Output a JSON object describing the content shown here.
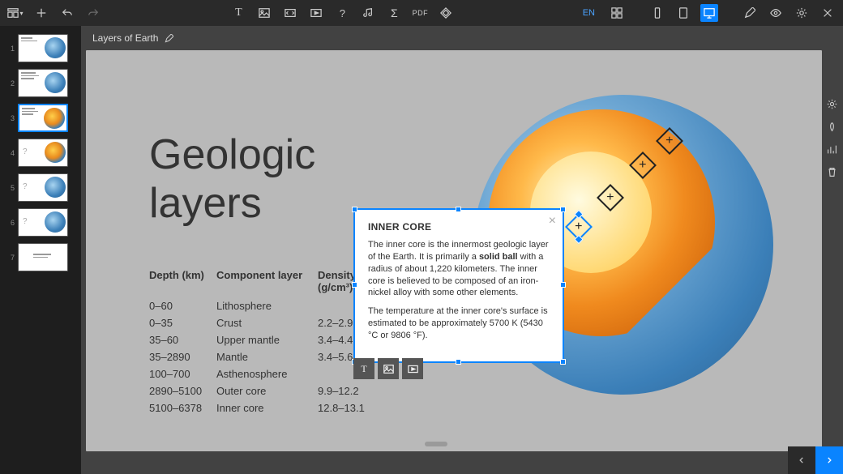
{
  "doc_title": "Layers of Earth",
  "lang": "EN",
  "pdf_label": "PDF",
  "slide_title_1": "Geologic",
  "slide_title_2": "layers",
  "table": {
    "head": {
      "depth": "Depth (km)",
      "layer": "Component layer",
      "density": "Density (g/cm³)"
    },
    "rows": [
      {
        "depth": "0–60",
        "layer": "Lithosphere",
        "density": ""
      },
      {
        "depth": "0–35",
        "layer": "Crust",
        "density": "2.2–2.9"
      },
      {
        "depth": "35–60",
        "layer": "Upper mantle",
        "density": "3.4–4.4"
      },
      {
        "depth": "35–2890",
        "layer": "Mantle",
        "density": "3.4–5.6"
      },
      {
        "depth": "100–700",
        "layer": "Asthenosphere",
        "density": ""
      },
      {
        "depth": "2890–5100",
        "layer": "Outer core",
        "density": "9.9–12.2"
      },
      {
        "depth": "5100–6378",
        "layer": "Inner core",
        "density": "12.8–13.1"
      }
    ]
  },
  "popup": {
    "title": "INNER CORE",
    "p1_a": "The inner core is the innermost geologic layer of the Earth. It is primarily a ",
    "p1_b": "solid ball",
    "p1_c": " with a radius of about 1,220 kilometers. The inner core is believed to be composed of an iron-nickel alloy with some other elements.",
    "p2": "The temperature at the inner core's surface is estimated to be approximately 5700 K (5430 °C or 9806 °F)."
  },
  "thumbs": [
    "1",
    "2",
    "3",
    "4",
    "5",
    "6",
    "7"
  ],
  "hotspots": {
    "plus": "+"
  }
}
